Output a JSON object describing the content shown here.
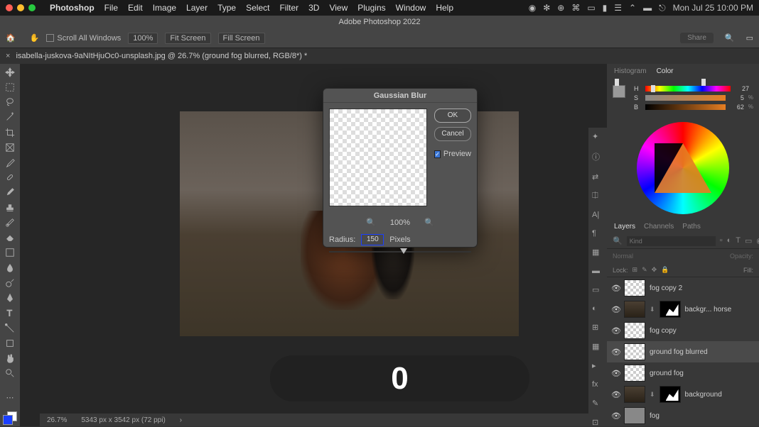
{
  "menubar": {
    "app": "Photoshop",
    "items": [
      "File",
      "Edit",
      "Image",
      "Layer",
      "Type",
      "Select",
      "Filter",
      "3D",
      "View",
      "Plugins",
      "Window",
      "Help"
    ],
    "datetime": "Mon Jul 25  10:00 PM"
  },
  "app_title": "Adobe Photoshop 2022",
  "options_bar": {
    "scroll_all": "Scroll All Windows",
    "zoom": "100%",
    "fit1": "Fit Screen",
    "fit2": "Fill Screen",
    "share": "Share"
  },
  "doc_tab": {
    "name": "isabella-juskova-9aNItHjuOc0-unsplash.jpg @ 26.7% (ground fog blurred, RGB/8*) *"
  },
  "dialog": {
    "title": "Gaussian Blur",
    "ok": "OK",
    "cancel": "Cancel",
    "preview_label": "Preview",
    "zoom_pct": "100%",
    "radius_label": "Radius:",
    "radius_value": "150",
    "radius_unit": "Pixels"
  },
  "overlay_char": "0",
  "status": {
    "zoom": "26.7%",
    "dims": "5343 px x 3542 px (72 ppi)"
  },
  "color_tabs": {
    "t1": "Histogram",
    "t2": "Color"
  },
  "hsb": {
    "h_label": "H",
    "h_val": "27",
    "s_label": "S",
    "s_val": "5",
    "s_pct": "%",
    "b_label": "B",
    "b_val": "62",
    "b_pct": "%"
  },
  "layer_tabs": {
    "t1": "Layers",
    "t2": "Channels",
    "t3": "Paths"
  },
  "layer_filter_placeholder": "Kind",
  "layer_blend": {
    "mode": "Normal",
    "opacity_label": "Opacity:"
  },
  "layer_lock": {
    "label": "Lock:",
    "fill_label": "Fill:"
  },
  "layers": [
    {
      "name": "fog copy 2",
      "checker": true
    },
    {
      "name": "backgr... horse",
      "masked": true,
      "dark": true
    },
    {
      "name": "fog copy",
      "checker": true
    },
    {
      "name": "ground fog blurred",
      "checker": true,
      "selected": true
    },
    {
      "name": "ground fog",
      "checker": true
    },
    {
      "name": "background",
      "masked": true,
      "dark": true
    },
    {
      "name": "fog",
      "plain": true
    }
  ]
}
